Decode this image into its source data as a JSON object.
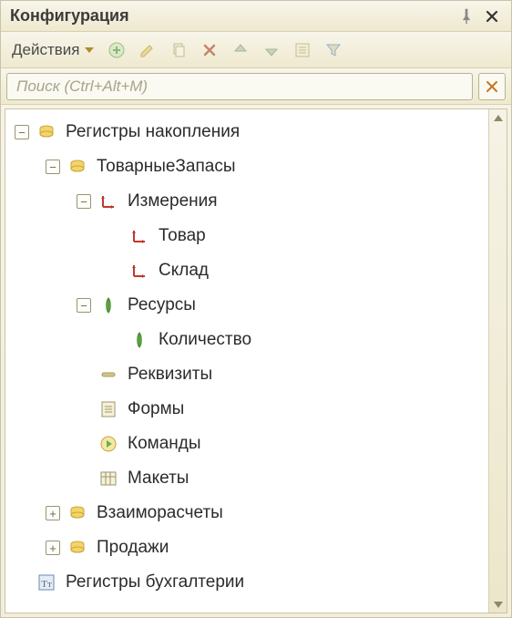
{
  "window": {
    "title": "Конфигурация"
  },
  "toolbar": {
    "actions_label": "Действия"
  },
  "search": {
    "placeholder": "Поиск (Ctrl+Alt+M)"
  },
  "tree": {
    "items": [
      {
        "indent": 0,
        "toggle": "minus",
        "icon": "register",
        "label": "Регистры накопления"
      },
      {
        "indent": 1,
        "toggle": "minus",
        "icon": "register",
        "label": "ТоварныеЗапасы"
      },
      {
        "indent": 2,
        "toggle": "minus",
        "icon": "dimension",
        "label": "Измерения"
      },
      {
        "indent": 3,
        "toggle": "none",
        "icon": "dimension",
        "label": "Товар"
      },
      {
        "indent": 3,
        "toggle": "none",
        "icon": "dimension",
        "label": "Склад"
      },
      {
        "indent": 2,
        "toggle": "minus",
        "icon": "resource",
        "label": "Ресурсы"
      },
      {
        "indent": 3,
        "toggle": "none",
        "icon": "resource",
        "label": "Количество"
      },
      {
        "indent": 2,
        "toggle": "none",
        "icon": "attribute",
        "label": "Реквизиты"
      },
      {
        "indent": 2,
        "toggle": "none",
        "icon": "forms",
        "label": "Формы"
      },
      {
        "indent": 2,
        "toggle": "none",
        "icon": "commands",
        "label": "Команды"
      },
      {
        "indent": 2,
        "toggle": "none",
        "icon": "templates",
        "label": "Макеты"
      },
      {
        "indent": 1,
        "toggle": "plus",
        "icon": "register",
        "label": "Взаиморасчеты"
      },
      {
        "indent": 1,
        "toggle": "plus",
        "icon": "register",
        "label": "Продажи"
      },
      {
        "indent": 0,
        "toggle": "none",
        "icon": "accounting",
        "label": "Регистры бухгалтерии"
      }
    ]
  }
}
